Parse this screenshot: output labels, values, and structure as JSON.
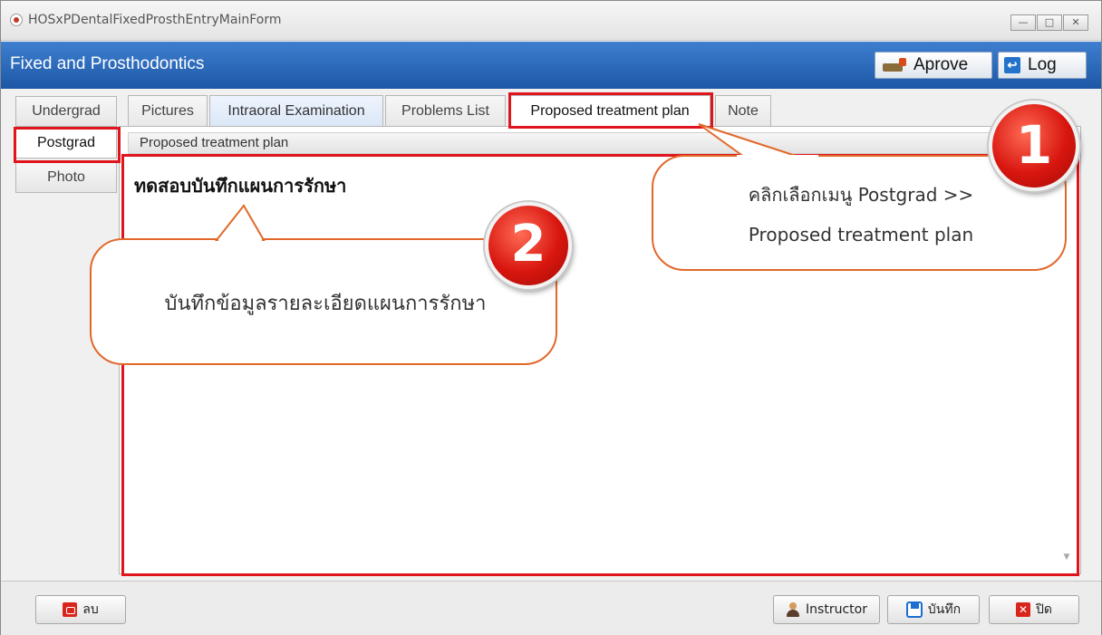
{
  "window": {
    "title": "HOSxPDentalFixedProsthEntryMainForm"
  },
  "header": {
    "title": "Fixed and Prosthodontics",
    "aprove_label": "Aprove",
    "log_label": "Log"
  },
  "left_tabs": [
    "Undergrad",
    "Postgrad",
    "Photo"
  ],
  "top_tabs": [
    "Pictures",
    "Intraoral Examination",
    "Problems List",
    "Proposed treatment plan",
    "Note"
  ],
  "panel": {
    "subheader": "Proposed treatment plan",
    "text": "ทดสอบบันทึกแผนการรักษา"
  },
  "callout1": {
    "number": "1",
    "line1": "คลิกเลือกเมนู Postgrad >>",
    "line2": "Proposed treatment plan"
  },
  "callout2": {
    "number": "2",
    "text": "บันทึกข้อมูลรายละเอียดแผนการรักษา"
  },
  "bottom": {
    "delete_label": "ลบ",
    "instructor_label": "Instructor",
    "save_label": "บันทึก",
    "close_label": "ปิด"
  },
  "colors": {
    "header": "#2a66b8",
    "highlight": "#e0141c",
    "callout_border": "#e2682a"
  }
}
